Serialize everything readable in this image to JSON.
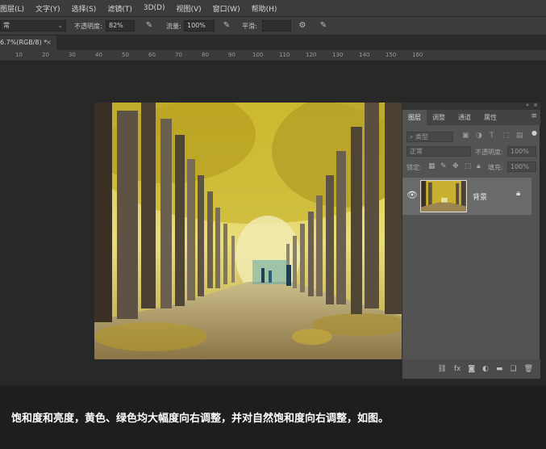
{
  "menu": [
    "图层(L)",
    "文字(Y)",
    "选择(S)",
    "滤镜(T)",
    "3D(D)",
    "视图(V)",
    "窗口(W)",
    "帮助(H)"
  ],
  "options": {
    "mode_value": "常",
    "opacity_label": "不透明度:",
    "opacity_value": "82%",
    "flow_label": "流量:",
    "flow_value": "100%",
    "smooth_label": "平滑:"
  },
  "document_tab": {
    "title": "6.7%(RGB/8) *",
    "close": "×"
  },
  "ruler_ticks": [
    "10",
    "20",
    "30",
    "40",
    "50",
    "60",
    "70",
    "80",
    "90",
    "100",
    "110",
    "120",
    "130",
    "140",
    "150",
    "160"
  ],
  "layers_panel": {
    "tabs": [
      "图层",
      "调整",
      "通道",
      "属性"
    ],
    "filter_kind": "类型",
    "blend_mode": "正常",
    "opacity_label": "不透明度:",
    "opacity_value": "100%",
    "lock_label": "锁定:",
    "fill_label": "填充:",
    "fill_value": "100%",
    "layer_name": "背景",
    "footer_icons": [
      "link-icon",
      "fx-icon",
      "mask-icon",
      "adjustment-icon",
      "folder-icon",
      "new-layer-icon",
      "trash-icon"
    ]
  },
  "caption": "饱和度和亮度，黄色、绿色均大幅度向右调整，并对自然饱和度向右调整，如图。",
  "colors": {
    "accent_photo_yellow": "#c9b030",
    "panel_bg": "#535353",
    "canvas_bg": "#282828"
  }
}
